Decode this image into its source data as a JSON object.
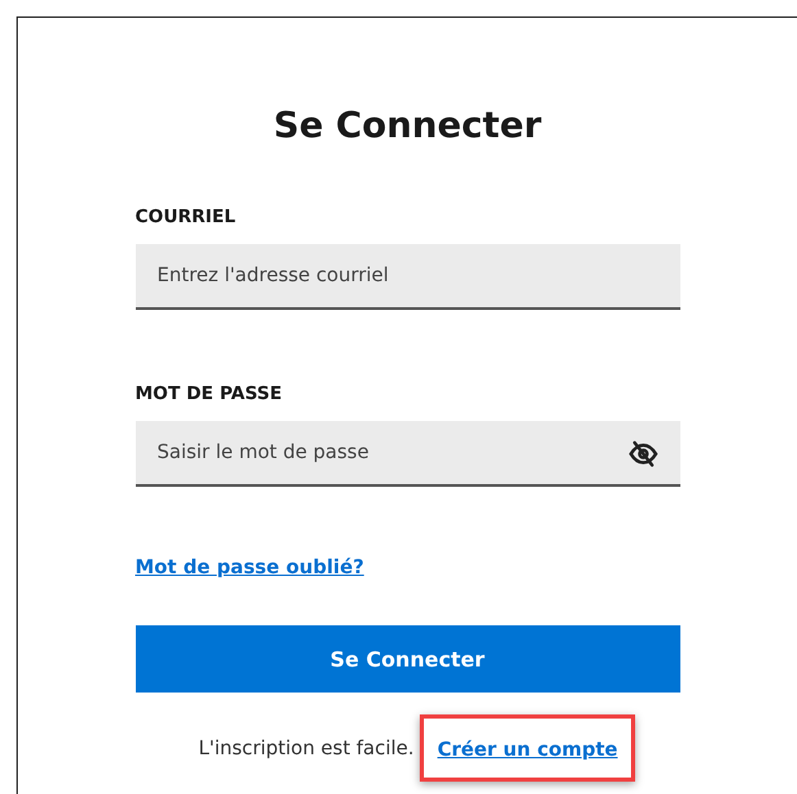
{
  "title": "Se Connecter",
  "fields": [
    {
      "label": "COURRIEL",
      "placeholder": "Entrez l'adresse courriel",
      "kind": "email"
    },
    {
      "label": "MOT DE PASSE",
      "placeholder": "Saisir le mot de passe",
      "kind": "password"
    }
  ],
  "forgot_link": "Mot de passe oublié?",
  "submit_button": "Se Connecter",
  "signup": {
    "text": "L'inscription est facile.",
    "link": "Créer un compte",
    "highlighted": true
  }
}
